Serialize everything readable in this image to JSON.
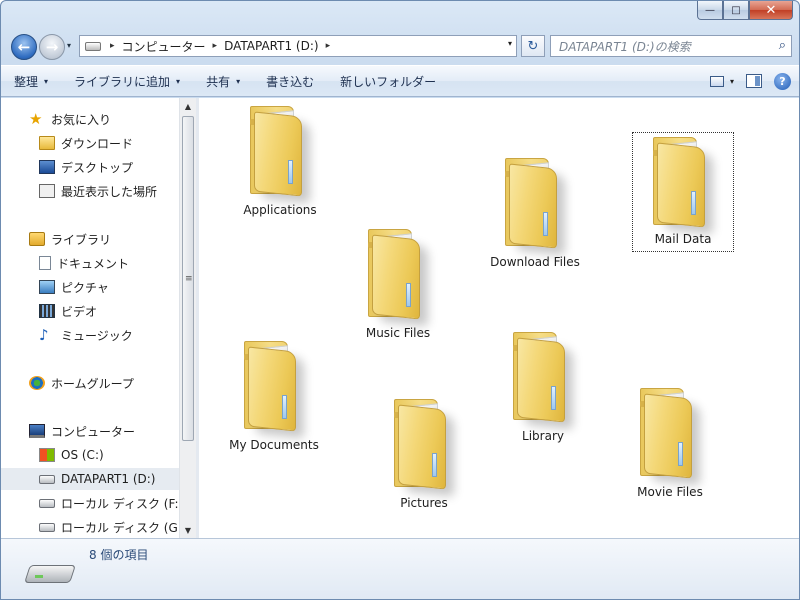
{
  "window": {
    "caption_buttons": {
      "minimize": "—",
      "maximize": "□",
      "close": "✕"
    }
  },
  "address_bar": {
    "crumbs": [
      "コンピューター",
      "DATAPART1 (D:)"
    ],
    "separator": "▸",
    "dropdown": "▾",
    "refresh_glyph": "↻"
  },
  "search": {
    "placeholder": "DATAPART1 (D:)の検索",
    "icon": "search-icon"
  },
  "toolbar": {
    "organize": "整理",
    "add_to_library": "ライブラリに追加",
    "share": "共有",
    "burn": "書き込む",
    "new_folder": "新しいフォルダー",
    "caret": "▾",
    "help": "?"
  },
  "nav": {
    "favorites": "お気に入り",
    "downloads": "ダウンロード",
    "desktop": "デスクトップ",
    "recent": "最近表示した場所",
    "libraries": "ライブラリ",
    "documents": "ドキュメント",
    "pictures": "ピクチャ",
    "videos": "ビデオ",
    "music": "ミュージック",
    "homegroup": "ホームグループ",
    "computer": "コンピューター",
    "os_c": "OS (C:)",
    "datapart1": "DATAPART1 (D:)",
    "local_disk_f": "ローカル ディスク (F:",
    "local_disk_g": "ローカル ディスク (G"
  },
  "folders": [
    "Applications",
    "Download Files",
    "Mail Data",
    "Music Files",
    "My Documents",
    "Library",
    "Pictures",
    "Movie Files"
  ],
  "status": {
    "item_count": "8 個の項目"
  }
}
